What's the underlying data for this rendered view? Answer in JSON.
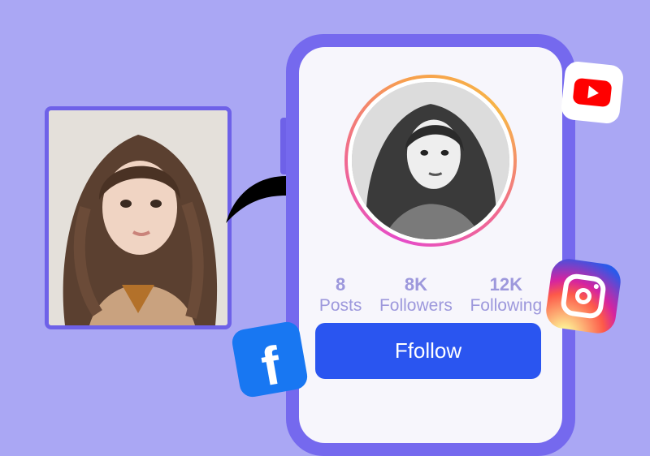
{
  "source_photo": {
    "alt": "Portrait photo of a young woman with long brown wavy hair"
  },
  "profile": {
    "avatar_alt": "Black-and-white sketch of the same woman",
    "stats": [
      {
        "value": "8",
        "label": "Posts"
      },
      {
        "value": "8K",
        "label": "Followers"
      },
      {
        "value": "12K",
        "label": "Following"
      }
    ],
    "follow_label": "Ffollow"
  },
  "social_icons": {
    "youtube": "youtube-icon",
    "instagram": "instagram-icon",
    "facebook_glyph": "f"
  },
  "colors": {
    "background": "#aaa7f4",
    "phone_frame": "#7569ee",
    "follow_button": "#2a55f0",
    "stat_text": "#9d98dc",
    "youtube_red": "#ff0000",
    "facebook_blue": "#1877f2"
  }
}
